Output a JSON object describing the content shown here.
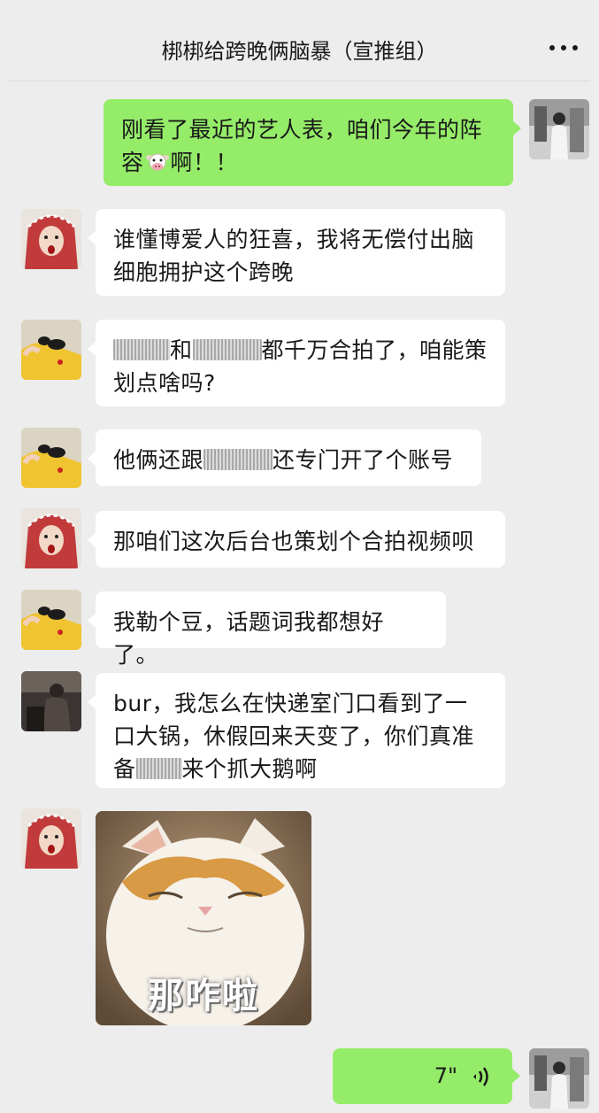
{
  "header": {
    "title": "梆梆给跨晚俩脑暴（宣推组）",
    "more_icon": "more-dots-icon"
  },
  "messages": [
    {
      "side": "out",
      "text_a": "刚看了最近的艺人表，咱们今年的阵",
      "text_b": "容",
      "emoji": "cow-face-icon",
      "text_c": "啊！！"
    },
    {
      "side": "in",
      "line1": "谁懂博爱人的狂喜，我将无偿付出脑",
      "line2": "细胞拥护这个跨晚"
    },
    {
      "side": "in",
      "mid1": "和",
      "mid2": "都千万合拍了，咱能策",
      "line2": "划点啥吗?"
    },
    {
      "side": "in",
      "pre": "他俩还跟",
      "post": "还专门开了个账号"
    },
    {
      "side": "in",
      "text": "那咱们这次后台也策划个合拍视频呗"
    },
    {
      "side": "in",
      "text": "我勒个豆，话题词我都想好了。"
    },
    {
      "side": "in",
      "line1": "bur，我怎么在快递室门口看到了一",
      "line2": "口大锅，休假回来天变了，你们真准",
      "line3_pre": "备",
      "line3_post": "来个抓大鹅啊"
    },
    {
      "side": "in",
      "sticker_caption": "那咋啦"
    },
    {
      "side": "out",
      "voice_duration": "7\"",
      "voice_icon": "voice-wave-icon"
    }
  ],
  "colors": {
    "background": "#ededed",
    "outgoing_bubble": "#95ec69",
    "incoming_bubble": "#ffffff"
  }
}
